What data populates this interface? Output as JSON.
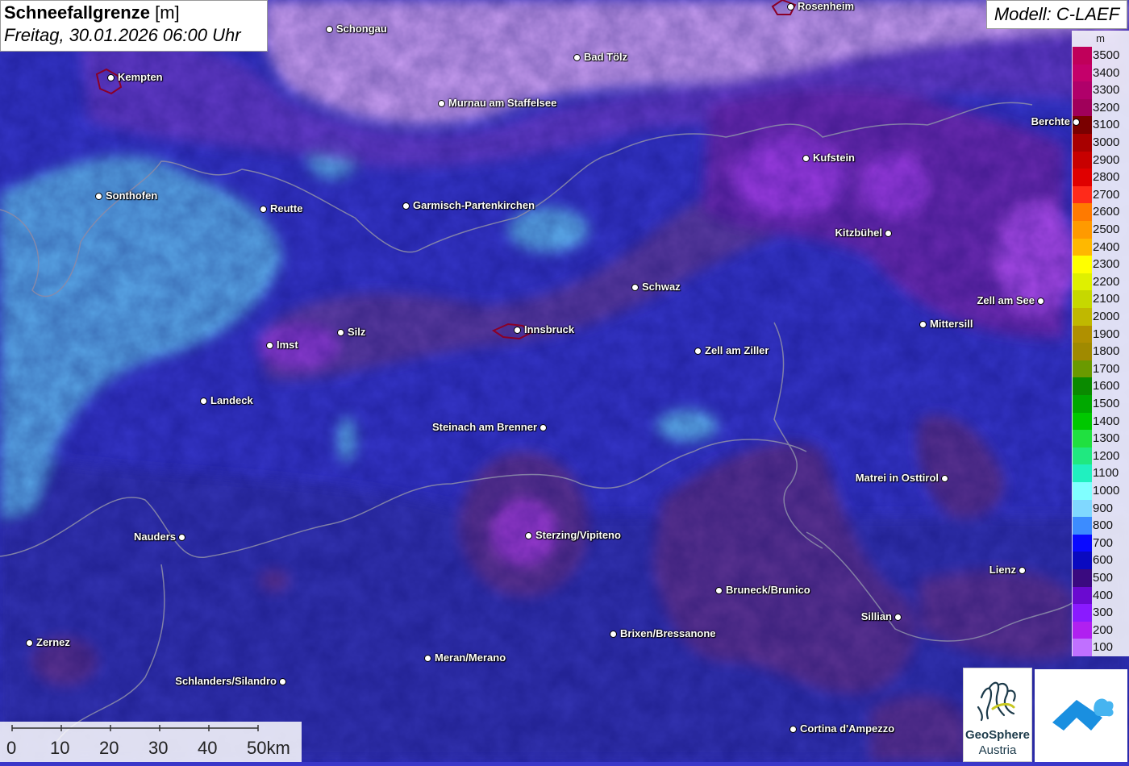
{
  "header": {
    "title_bold": "Schneefallgrenze",
    "title_unit": "[m]",
    "datetime": "Freitag, 30.01.2026 06:00 Uhr"
  },
  "model": "Modell: C-LAEF",
  "legend": {
    "unit": "m",
    "levels": [
      {
        "value": "3500",
        "color": "#c0005a"
      },
      {
        "value": "3400",
        "color": "#c4006a"
      },
      {
        "value": "3300",
        "color": "#b0006a"
      },
      {
        "value": "3200",
        "color": "#a0005a"
      },
      {
        "value": "3100",
        "color": "#7a0000"
      },
      {
        "value": "3000",
        "color": "#a80000"
      },
      {
        "value": "2900",
        "color": "#c80000"
      },
      {
        "value": "2800",
        "color": "#e00000"
      },
      {
        "value": "2700",
        "color": "#ff2a1a"
      },
      {
        "value": "2600",
        "color": "#ff7a00"
      },
      {
        "value": "2500",
        "color": "#ff9a00"
      },
      {
        "value": "2400",
        "color": "#ffb800"
      },
      {
        "value": "2300",
        "color": "#ffff00"
      },
      {
        "value": "2200",
        "color": "#dff000"
      },
      {
        "value": "2100",
        "color": "#c6d800"
      },
      {
        "value": "2000",
        "color": "#c0b800"
      },
      {
        "value": "1900",
        "color": "#b09000"
      },
      {
        "value": "1800",
        "color": "#a08a00"
      },
      {
        "value": "1700",
        "color": "#6a9a00"
      },
      {
        "value": "1600",
        "color": "#0a8a00"
      },
      {
        "value": "1500",
        "color": "#00a800"
      },
      {
        "value": "1400",
        "color": "#00c800"
      },
      {
        "value": "1300",
        "color": "#20e040"
      },
      {
        "value": "1200",
        "color": "#20e880"
      },
      {
        "value": "1100",
        "color": "#20f0c0"
      },
      {
        "value": "1000",
        "color": "#80ffff"
      },
      {
        "value": "900",
        "color": "#80d8ff"
      },
      {
        "value": "800",
        "color": "#3c8cff"
      },
      {
        "value": "700",
        "color": "#0a0aff"
      },
      {
        "value": "600",
        "color": "#0a0ac0"
      },
      {
        "value": "500",
        "color": "#3a0a80"
      },
      {
        "value": "400",
        "color": "#6a0ad0"
      },
      {
        "value": "300",
        "color": "#8a1aff"
      },
      {
        "value": "200",
        "color": "#b020f0"
      },
      {
        "value": "100",
        "color": "#c070ff"
      }
    ]
  },
  "cities": [
    {
      "name": "Rosenheim"
    },
    {
      "name": "Schongau"
    },
    {
      "name": "Bad Tölz"
    },
    {
      "name": "Kempten"
    },
    {
      "name": "Murnau am Staffelsee"
    },
    {
      "name": "Berchte"
    },
    {
      "name": "Kufstein"
    },
    {
      "name": "Sonthofen"
    },
    {
      "name": "Reutte"
    },
    {
      "name": "Garmisch-Partenkirchen"
    },
    {
      "name": "Kitzbühel"
    },
    {
      "name": "Schwaz"
    },
    {
      "name": "Zell am See"
    },
    {
      "name": "Mittersill"
    },
    {
      "name": "Silz"
    },
    {
      "name": "Innsbruck"
    },
    {
      "name": "Imst"
    },
    {
      "name": "Zell am Ziller"
    },
    {
      "name": "Landeck"
    },
    {
      "name": "Steinach am Brenner"
    },
    {
      "name": "Matrei in Osttirol"
    },
    {
      "name": "Nauders"
    },
    {
      "name": "Sterzing/Vipiteno"
    },
    {
      "name": "Lienz"
    },
    {
      "name": "Bruneck/Brunico"
    },
    {
      "name": "Sillian"
    },
    {
      "name": "Brixen/Bressanone"
    },
    {
      "name": "Zernez"
    },
    {
      "name": "Meran/Merano"
    },
    {
      "name": "Schlanders/Silandro"
    },
    {
      "name": "Cortina d'Ampezzo"
    }
  ],
  "scale": {
    "labels": [
      "0",
      "10",
      "20",
      "30",
      "40",
      "50km"
    ]
  },
  "logos": {
    "geosphere_line1": "GeoSphere",
    "geosphere_line2": "Austria"
  }
}
